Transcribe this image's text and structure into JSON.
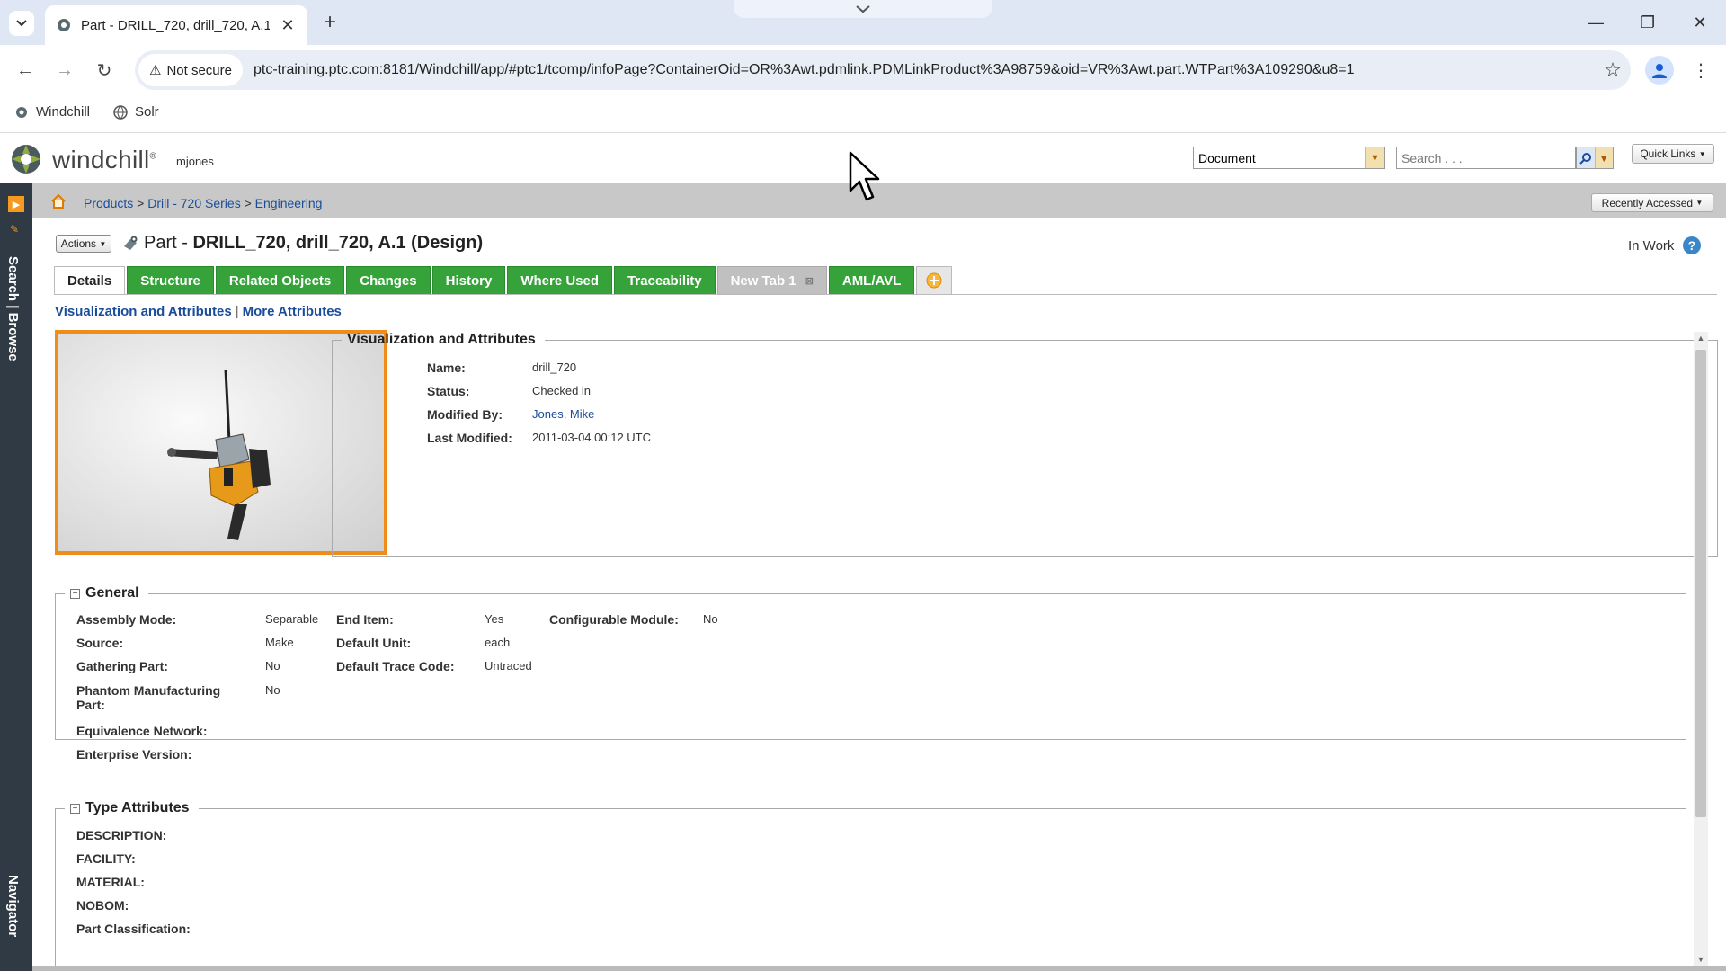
{
  "browser": {
    "tab_title": "Part - DRILL_720, drill_720, A.1 (",
    "security_label": "Not secure",
    "url": "ptc-training.ptc.com:8181/Windchill/app/#ptc1/tcomp/infoPage?ContainerOid=OR%3Awt.pdmlink.PDMLinkProduct%3A98759&oid=VR%3Awt.part.WTPart%3A109290&u8=1",
    "bookmarks": [
      "Windchill",
      "Solr"
    ]
  },
  "header": {
    "brand": "windchill",
    "trademark": "®",
    "user": "mjones",
    "search_type": "Document",
    "search_placeholder": "Search . . .",
    "quick_links": "Quick Links"
  },
  "navigator": {
    "search_browse": "Search | Browse",
    "navigator": "Navigator"
  },
  "breadcrumb": {
    "items": [
      "Products",
      "Drill - 720 Series",
      "Engineering"
    ],
    "separator": ">",
    "recently_accessed": "Recently Accessed"
  },
  "page": {
    "actions": "Actions",
    "title_prefix": "Part - ",
    "title_main": "DRILL_720, drill_720, A.1 (Design)",
    "state": "In Work"
  },
  "tabs": [
    {
      "label": "Details",
      "style": "active"
    },
    {
      "label": "Structure",
      "style": "green"
    },
    {
      "label": "Related Objects",
      "style": "green"
    },
    {
      "label": "Changes",
      "style": "green"
    },
    {
      "label": "History",
      "style": "green"
    },
    {
      "label": "Where Used",
      "style": "green"
    },
    {
      "label": "Traceability",
      "style": "green"
    },
    {
      "label": "New Tab 1",
      "style": "gray"
    },
    {
      "label": "AML/AVL",
      "style": "green"
    }
  ],
  "sublinks": {
    "visualization": "Visualization and Attributes",
    "separator": "|",
    "more": "More Attributes"
  },
  "visualization": {
    "legend": "Visualization and Attributes",
    "name_label": "Name:",
    "name_value": "drill_720",
    "status_label": "Status:",
    "status_value": "Checked in",
    "modified_by_label": "Modified By:",
    "modified_by_value": "Jones, Mike",
    "last_modified_label": "Last Modified:",
    "last_modified_value": "2011-03-04 00:12 UTC"
  },
  "general": {
    "legend": "General",
    "collapse": "⊟",
    "assembly_mode_label": "Assembly Mode:",
    "assembly_mode_value": "Separable",
    "source_label": "Source:",
    "source_value": "Make",
    "gathering_part_label": "Gathering Part:",
    "gathering_part_value": "No",
    "phantom_label_line1": "Phantom Manufacturing",
    "phantom_label_line2": "Part:",
    "phantom_value": "No",
    "equivalence_label": "Equivalence Network:",
    "enterprise_label": "Enterprise Version:",
    "end_item_label": "End Item:",
    "end_item_value": "Yes",
    "default_unit_label": "Default Unit:",
    "default_unit_value": "each",
    "trace_code_label": "Default Trace Code:",
    "trace_code_value": "Untraced",
    "configurable_label": "Configurable Module:",
    "configurable_value": "No"
  },
  "type_attributes": {
    "legend": "Type Attributes",
    "collapse": "⊟",
    "description_label": "DESCRIPTION:",
    "facility_label": "FACILITY:",
    "material_label": "MATERIAL:",
    "nobom_label": "NOBOM:",
    "classification_label": "Part Classification:"
  },
  "colors": {
    "tab_green": "#36a33a",
    "thumbnail_border": "#f08c1a",
    "link_blue": "#1a4d99",
    "navigator_bg": "#2f3a44"
  }
}
